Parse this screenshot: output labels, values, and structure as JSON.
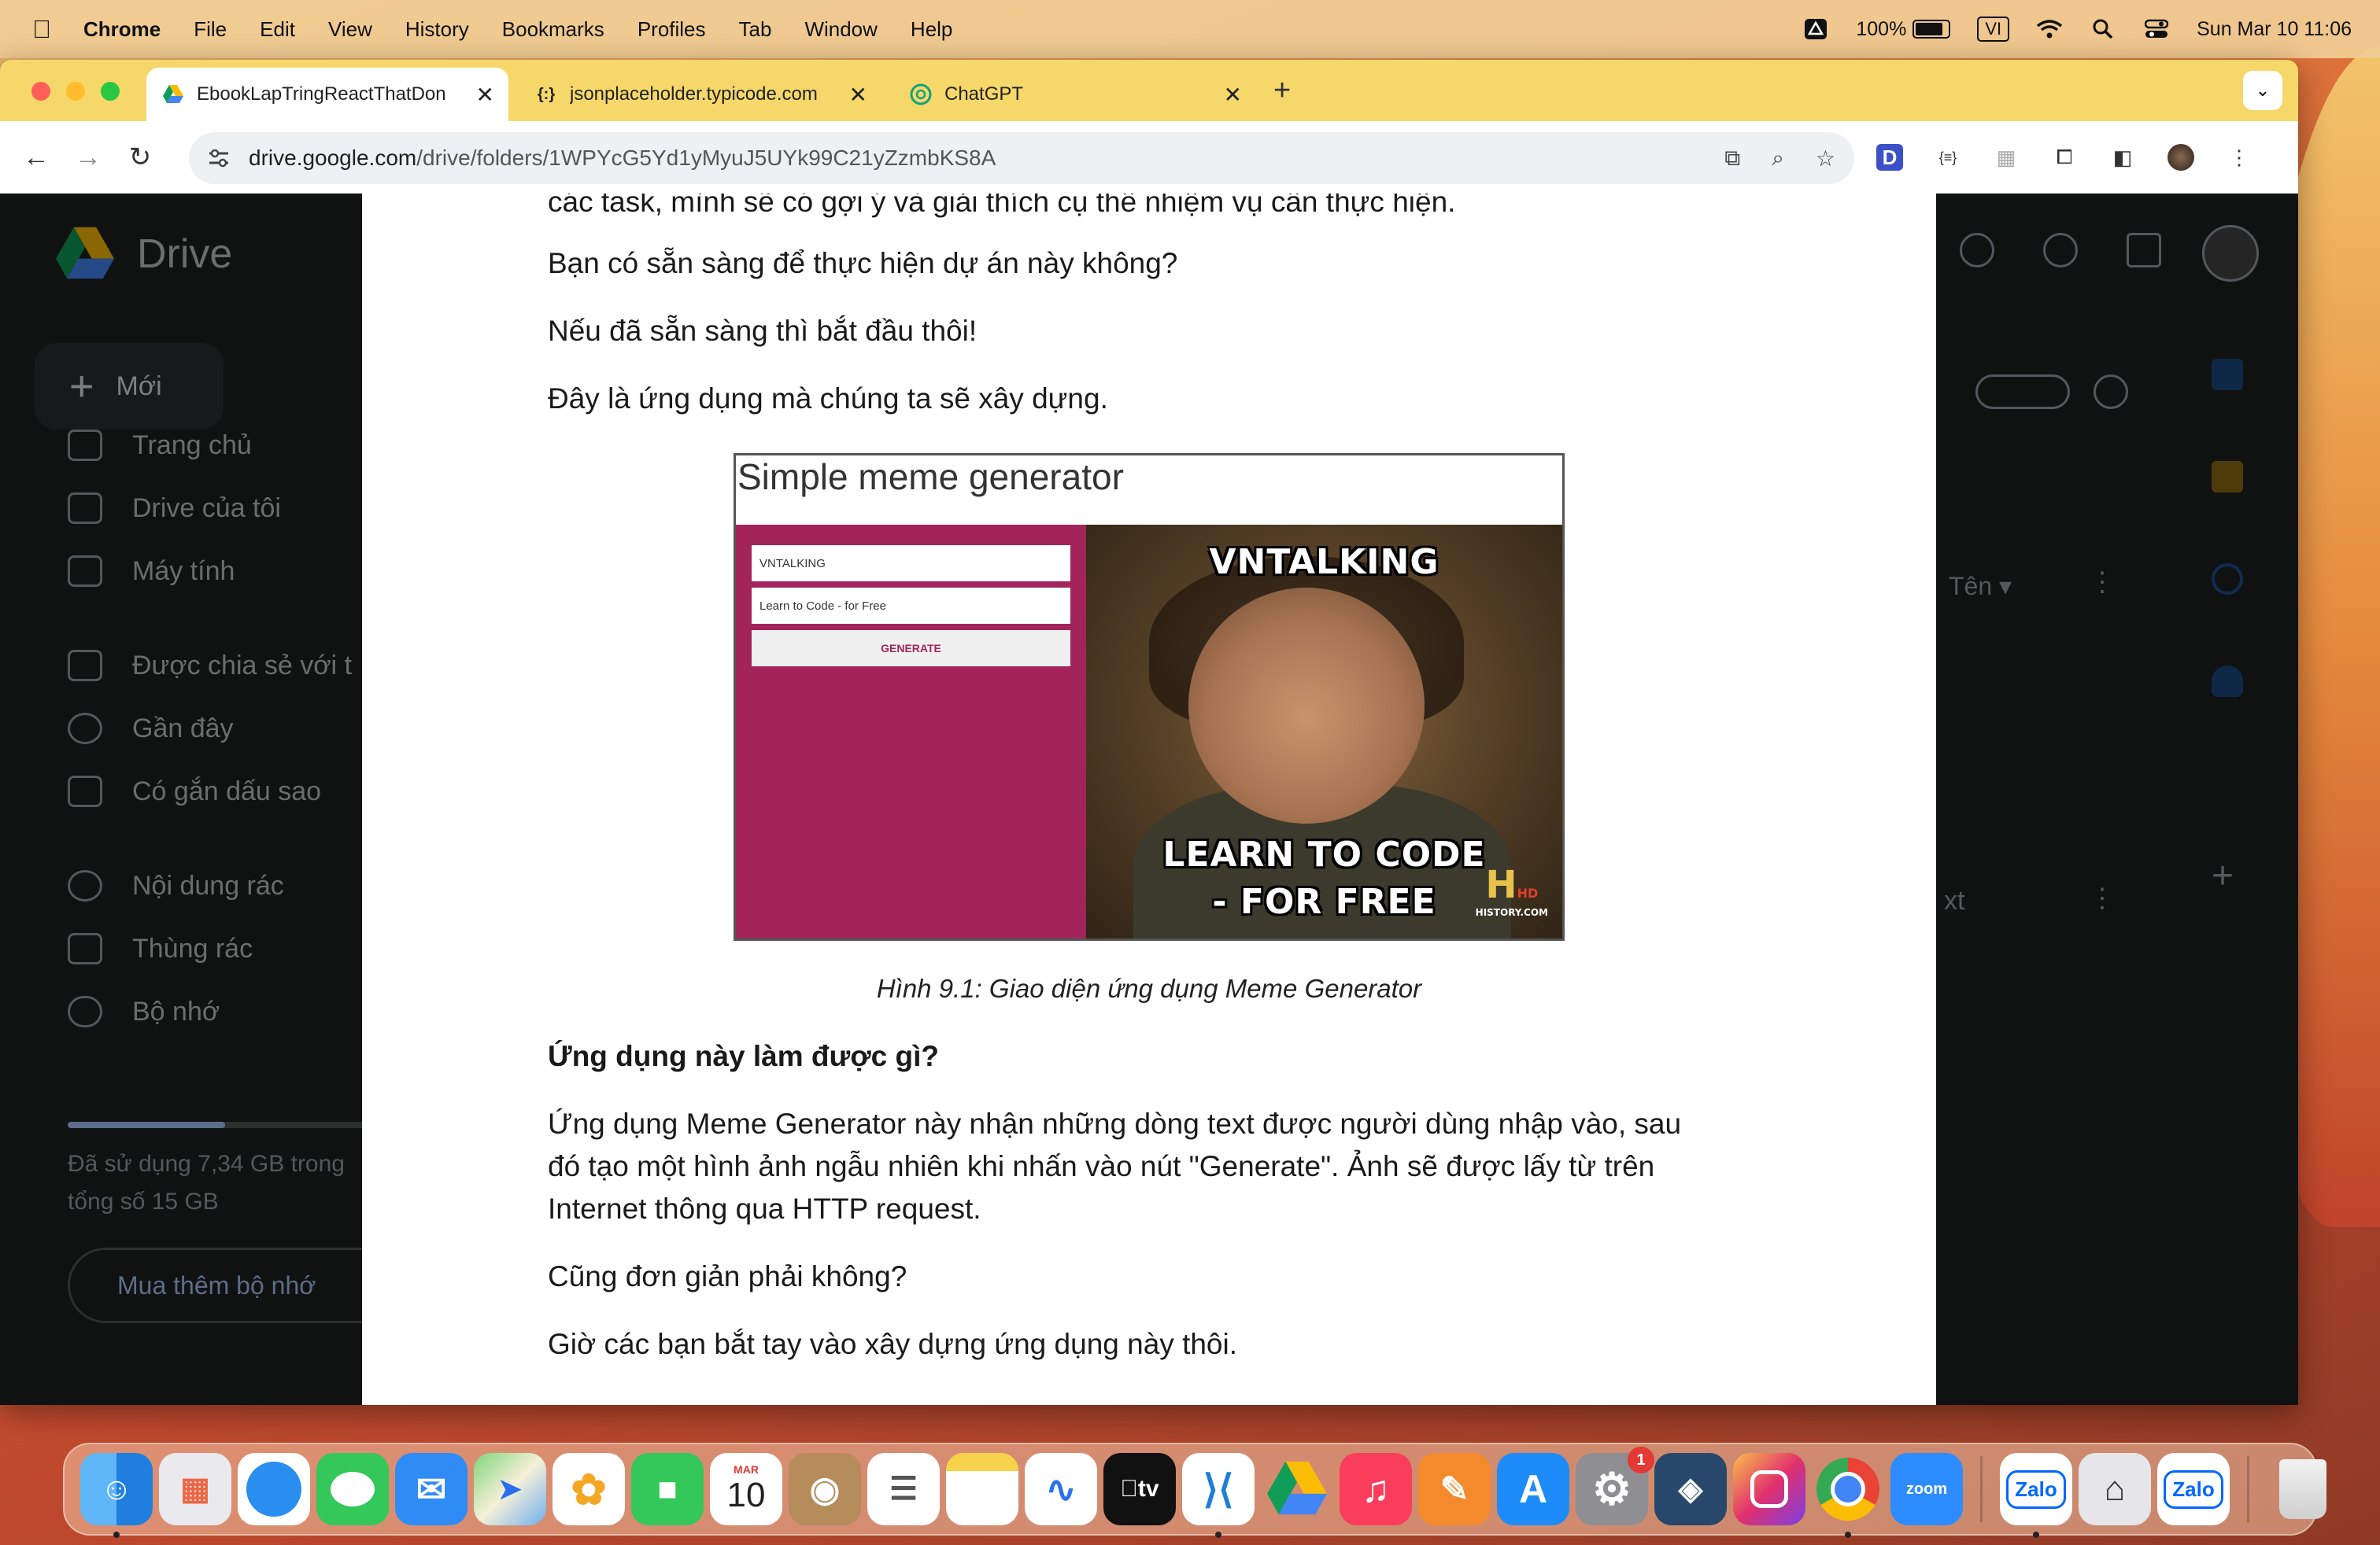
{
  "menubar": {
    "app_name": "Chrome",
    "items": [
      "File",
      "Edit",
      "View",
      "History",
      "Bookmarks",
      "Profiles",
      "Tab",
      "Window",
      "Help"
    ],
    "battery": "100%",
    "input_source": "VI",
    "datetime": "Sun Mar 10  11:06"
  },
  "browser": {
    "tabs": [
      {
        "title": "EbookLapTringReactThatDon",
        "icon": "google-drive-icon",
        "active": true
      },
      {
        "title": "jsonplaceholder.typicode.com",
        "icon": "json-icon",
        "active": false
      },
      {
        "title": "ChatGPT",
        "icon": "chatgpt-icon",
        "active": false
      }
    ],
    "url_host": "drive.google.com",
    "url_path": "/drive/folders/1WPYcG5Yd1yMyuJ5UYk99C21yZzmbKS8A"
  },
  "drive": {
    "brand": "Drive",
    "new_label": "Mới",
    "nav": [
      "Trang chủ",
      "Drive của tôi",
      "Máy tính",
      "Được chia sẻ với t",
      "Gần đây",
      "Có gắn dấu sao",
      "Nội dung rác",
      "Thùng rác",
      "Bộ nhớ"
    ],
    "storage_text": "Đã sử dụng 7,34 GB trong tổng số 15 GB",
    "buy_label": "Mua thêm bộ nhớ",
    "sort_label": "Tên",
    "partial_text": "xt"
  },
  "document": {
    "top_line": "các task, mình sẽ có gợi ý và giải thích cụ thể nhiệm vụ cần thực hiện.",
    "p1": "Bạn có sẵn sàng để thực hiện dự án này không?",
    "p2": "Nếu đã sẵn sàng thì bắt đầu thôi!",
    "p3": "Đây là ứng dụng mà chúng ta sẽ xây dựng.",
    "figure": {
      "title": "Simple meme generator",
      "input1": "VNTALKING",
      "input2": "Learn to Code - for Free",
      "button": "GENERATE",
      "meme_top": "VNTALKING",
      "meme_bottom1": "LEARN TO CODE",
      "meme_bottom2": "- FOR FREE",
      "logo_letter": "H",
      "logo_hd": "HD",
      "logo_site": "HISTORY.COM"
    },
    "caption": "Hình  9.1:  Giao diện ứng dụng Meme Generator",
    "heading": "Ứng dụng này làm được gì?",
    "p4_l1": "Ứng dụng Meme Generator này nhận những dòng text được người dùng nhập vào, sau",
    "p4_l2": "đó tạo một hình ảnh ngẫu nhiên khi nhấn vào nút \"Generate\". Ảnh sẽ được lấy  từ trên",
    "p4_l3": "Internet thông qua HTTP request.",
    "p5": "Cũng đơn giản phải không?",
    "p6": "Giờ các bạn bắt tay vào xây dựng ứng dụng này thôi."
  },
  "dock": {
    "calendar_month": "MAR",
    "calendar_day": "10",
    "settings_badge": "1",
    "apps": [
      "Finder",
      "Launchpad",
      "Safari",
      "Messages",
      "Mail",
      "Maps",
      "Photos",
      "FaceTime",
      "Calendar",
      "Contacts",
      "Reminders",
      "Notes",
      "Freeform",
      "TV",
      "Visual Studio Code",
      "Google Drive",
      "Music",
      "Pages",
      "App Store",
      "System Settings",
      "MySQL Workbench",
      "Instagram",
      "Chrome",
      "Zoom",
      "Zalo",
      "Preview",
      "Zalo",
      "Trash"
    ],
    "tv_label": "tv",
    "zoom_label": "zoom",
    "zalo_label": "Zalo"
  }
}
